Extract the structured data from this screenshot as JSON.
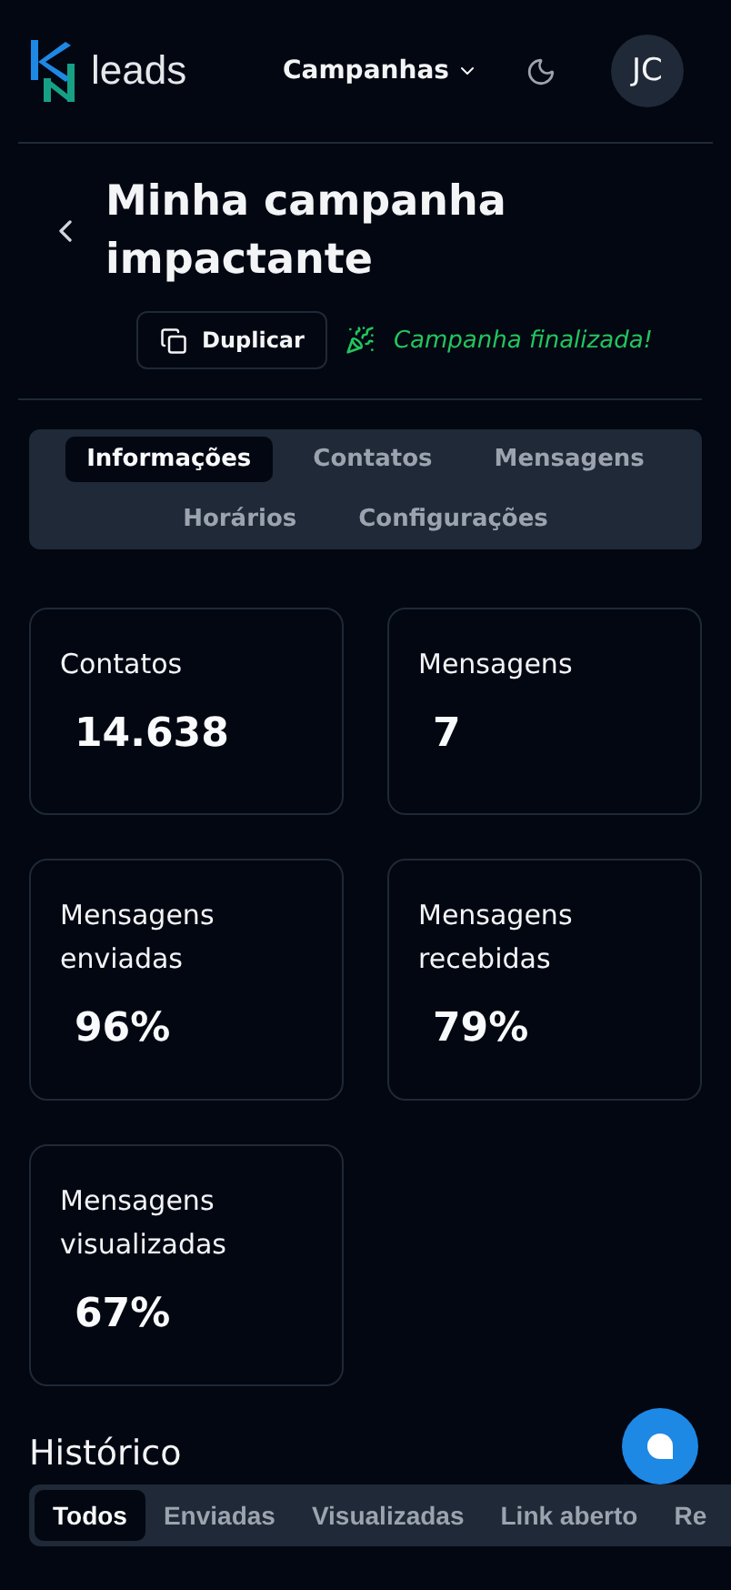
{
  "header": {
    "brand": "leads",
    "nav_menu": "Campanhas",
    "avatar": "JC"
  },
  "campaign": {
    "title": "Minha campanha impactante",
    "duplicate_button": "Duplicar",
    "status": "Campanha finalizada!"
  },
  "tabs": [
    {
      "label": "Informações",
      "selected": true
    },
    {
      "label": "Contatos",
      "selected": false
    },
    {
      "label": "Mensagens",
      "selected": false
    },
    {
      "label": "Horários",
      "selected": false
    },
    {
      "label": "Configurações",
      "selected": false
    }
  ],
  "stats": [
    {
      "label": "Contatos",
      "value": "14.638"
    },
    {
      "label": "Mensagens",
      "value": "7"
    },
    {
      "label": "Mensagens enviadas",
      "value": "96%"
    },
    {
      "label": "Mensagens recebidas",
      "value": "79%"
    },
    {
      "label": "Mensagens visualizadas",
      "value": "67%"
    }
  ],
  "history": {
    "title": "Histórico",
    "filters": [
      {
        "label": "Todos",
        "selected": true
      },
      {
        "label": "Enviadas",
        "selected": false
      },
      {
        "label": "Visualizadas",
        "selected": false
      },
      {
        "label": "Link aberto",
        "selected": false
      },
      {
        "label": "Re",
        "selected": false
      }
    ]
  }
}
